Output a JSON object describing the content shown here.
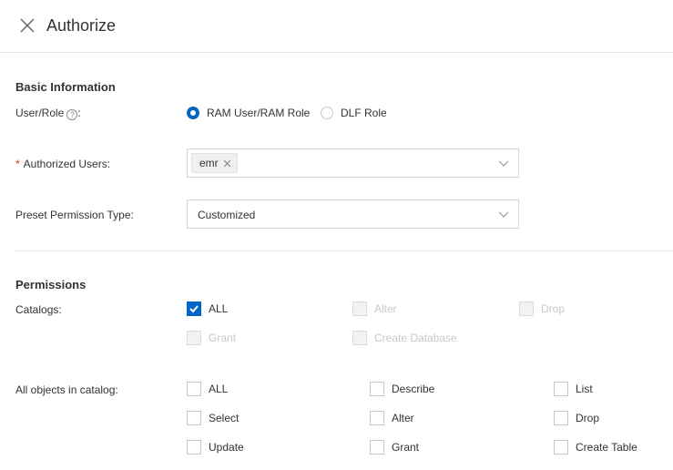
{
  "header": {
    "title": "Authorize",
    "close_icon": "close-icon"
  },
  "basic": {
    "section_title": "Basic Information",
    "user_role": {
      "label": "User/Role",
      "colon": ":",
      "help_icon": "question-circle-icon",
      "options": [
        {
          "label": "RAM User/RAM Role",
          "checked": true
        },
        {
          "label": "DLF Role",
          "checked": false
        }
      ]
    },
    "authorized_users": {
      "required_mark": "*",
      "label": "Authorized Users",
      "colon": ":",
      "tags": [
        "emr"
      ]
    },
    "preset_permission": {
      "label": "Preset Permission Type",
      "colon": ":",
      "value": "Customized"
    }
  },
  "permissions": {
    "section_title": "Permissions",
    "catalogs": {
      "label": "Catalogs",
      "colon": ":",
      "options": [
        {
          "label": "ALL",
          "checked": true,
          "disabled": false
        },
        {
          "label": "Alter",
          "checked": false,
          "disabled": true
        },
        {
          "label": "Drop",
          "checked": false,
          "disabled": true
        },
        {
          "label": "Grant",
          "checked": false,
          "disabled": true
        },
        {
          "label": "Create Database",
          "checked": false,
          "disabled": true
        }
      ]
    },
    "all_objects": {
      "label": "All objects in catalog",
      "colon": ":",
      "options": [
        {
          "label": "ALL",
          "checked": false,
          "disabled": false
        },
        {
          "label": "Describe",
          "checked": false,
          "disabled": false
        },
        {
          "label": "List",
          "checked": false,
          "disabled": false
        },
        {
          "label": "Select",
          "checked": false,
          "disabled": false
        },
        {
          "label": "Alter",
          "checked": false,
          "disabled": false
        },
        {
          "label": "Drop",
          "checked": false,
          "disabled": false
        },
        {
          "label": "Update",
          "checked": false,
          "disabled": false
        },
        {
          "label": "Grant",
          "checked": false,
          "disabled": false
        },
        {
          "label": "Create Table",
          "checked": false,
          "disabled": false
        }
      ]
    }
  },
  "colors": {
    "primary": "#0064c8",
    "required": "#d93026",
    "border": "#d6d6d6",
    "disabled_text": "#c8c8c8"
  }
}
